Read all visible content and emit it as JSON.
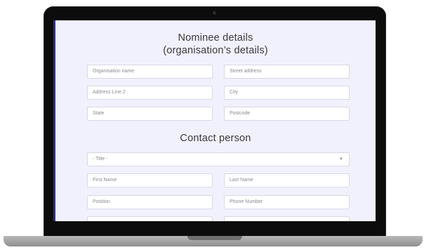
{
  "form": {
    "nominee_title_line1": "Nominee details",
    "nominee_title_line2": "(organisation’s details)",
    "contact_title": "Contact person",
    "fields": {
      "organisation_name": "Organisation name",
      "street_address": "Street address",
      "address_line_2": "Address Line 2",
      "city": "City",
      "state": "State",
      "postcode": "Postcode",
      "title_select": "- Title -",
      "first_name": "First Name",
      "last_name": "Last Name",
      "position": "Position",
      "phone_number": "Phone Number"
    }
  },
  "colors": {
    "screen_background": "#f1f0fd",
    "accent_border": "#2d2f8f",
    "bezel": "#0c0c0c"
  },
  "icons": {
    "select_caret": "chevron-down-icon"
  }
}
